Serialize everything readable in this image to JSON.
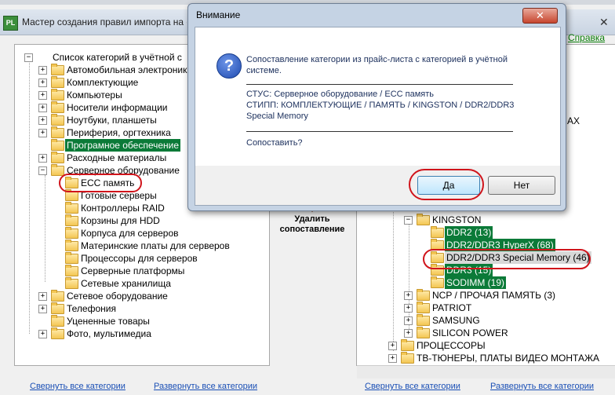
{
  "main_window": {
    "title": "Мастер создания правил импорта на с",
    "help_label": "Справка",
    "app_icon_text": "PL"
  },
  "left_tree": {
    "root": "Список категорий в учётной с",
    "items": [
      "Автомобильная электроника",
      "Комплектующие",
      "Компьютеры",
      "Носители информации",
      "Ноутбуки, планшеты",
      "Периферия, оргтехника",
      "Програмное обеспечение",
      "Расходные материалы",
      "Серверное оборудование"
    ],
    "server_children": [
      "ECC память",
      "Готовые серверы",
      "Контроллеры RAID",
      "Корзины для HDD",
      "Корпуса для серверов",
      "Материнские платы для серверов",
      "Процессоры для серверов",
      "Серверные платформы",
      "Сетевые хранилища"
    ],
    "tail_items": [
      "Сетевое оборудование",
      "Телефония",
      "Уцененные товары",
      "Фото, мультимедиа"
    ]
  },
  "right_tree": {
    "partial_label": "AX",
    "kingston": "KINGSTON",
    "kingston_children": [
      "DDR2 (13)",
      "DDR2/DDR3 HyperX (68)",
      "DDR2/DDR3 Special Memory (46)",
      "DDR3 (15)",
      "SODIMM (19)"
    ],
    "siblings": [
      "NCP / ПРОЧАЯ  ПАМЯТЬ (3)",
      "PATRIOT",
      "SAMSUNG",
      "SILICON POWER"
    ],
    "top_items": [
      "ПРОЦЕССОРЫ",
      "ТВ-ТЮНЕРЫ, ПЛАТЫ ВИДЕО МОНТАЖА"
    ]
  },
  "middle": {
    "remove_label": "Удалить сопоставление"
  },
  "bottom_links": {
    "collapse": "Свернуть все категории",
    "expand": "Развернуть все категории"
  },
  "dialog": {
    "title": "Внимание",
    "close_label": "✕",
    "question": "Сопоставление категории из прайс-листа с категорией в учётной системе.",
    "stus": "СТУС: Серверное оборудование / ЕСС память",
    "stipp": "СТИПП: КОМПЛЕКТУЮЩИЕ / ПАМЯТЬ / KINGSTON / DDR2/DDR3 Special Memory",
    "confirm": "Сопоставить?",
    "yes_label": "Да",
    "no_label": "Нет"
  },
  "accent_colors": {
    "selection": "#0b7a38",
    "annotation": "#d0141b",
    "link": "#1a4fb5"
  }
}
